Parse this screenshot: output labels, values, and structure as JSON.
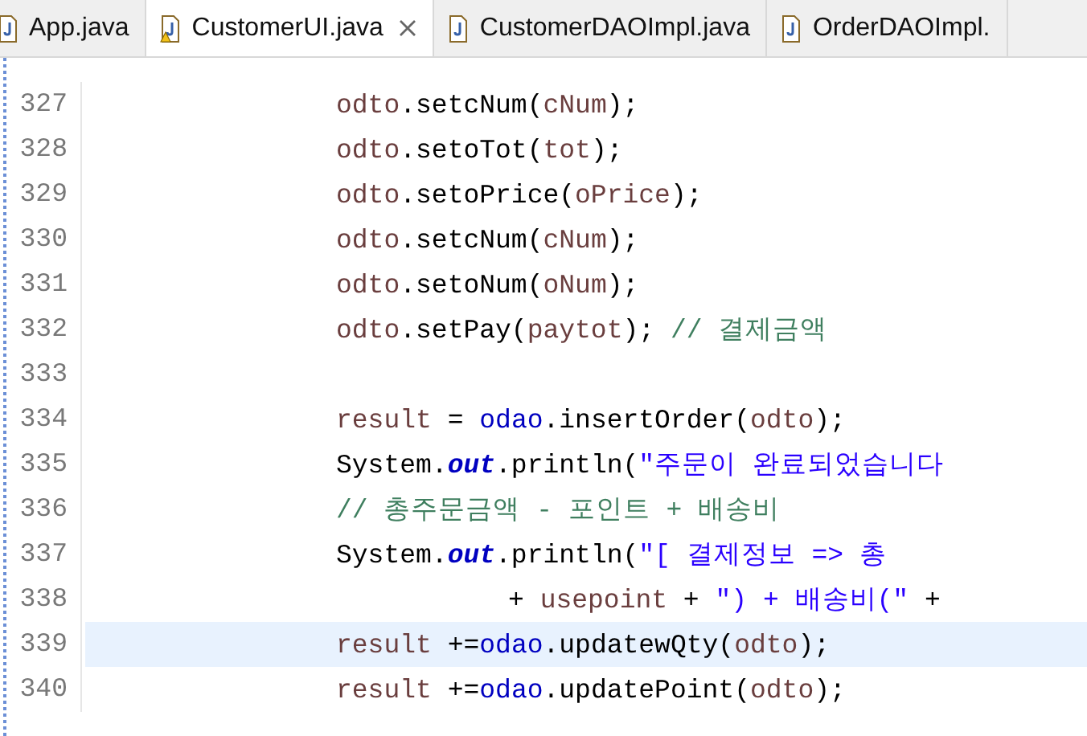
{
  "tabs": [
    {
      "label": "App.java",
      "selected": false,
      "warning": false,
      "closable": false
    },
    {
      "label": "CustomerUI.java",
      "selected": true,
      "warning": true,
      "closable": true
    },
    {
      "label": "CustomerDAOImpl.java",
      "selected": false,
      "warning": false,
      "closable": false
    },
    {
      "label": "OrderDAOImpl.",
      "selected": false,
      "warning": false,
      "closable": false
    }
  ],
  "lines": [
    {
      "number": "327",
      "kind": "code",
      "current": false,
      "tokens": [
        {
          "kind": "var",
          "text": "odto"
        },
        {
          "kind": "plain",
          "text": ".setcNum("
        },
        {
          "kind": "var",
          "text": "cNum"
        },
        {
          "kind": "plain",
          "text": ");"
        }
      ]
    },
    {
      "number": "328",
      "kind": "code",
      "current": false,
      "tokens": [
        {
          "kind": "var",
          "text": "odto"
        },
        {
          "kind": "plain",
          "text": ".setoTot("
        },
        {
          "kind": "var",
          "text": "tot"
        },
        {
          "kind": "plain",
          "text": ");"
        }
      ]
    },
    {
      "number": "329",
      "kind": "code",
      "current": false,
      "tokens": [
        {
          "kind": "var",
          "text": "odto"
        },
        {
          "kind": "plain",
          "text": ".setoPrice("
        },
        {
          "kind": "var",
          "text": "oPrice"
        },
        {
          "kind": "plain",
          "text": ");"
        }
      ]
    },
    {
      "number": "330",
      "kind": "code",
      "current": false,
      "tokens": [
        {
          "kind": "var",
          "text": "odto"
        },
        {
          "kind": "plain",
          "text": ".setcNum("
        },
        {
          "kind": "var",
          "text": "cNum"
        },
        {
          "kind": "plain",
          "text": ");"
        }
      ]
    },
    {
      "number": "331",
      "kind": "code",
      "current": false,
      "tokens": [
        {
          "kind": "var",
          "text": "odto"
        },
        {
          "kind": "plain",
          "text": ".setoNum("
        },
        {
          "kind": "var",
          "text": "oNum"
        },
        {
          "kind": "plain",
          "text": ");"
        }
      ]
    },
    {
      "number": "332",
      "kind": "code",
      "current": false,
      "tokens": [
        {
          "kind": "var",
          "text": "odto"
        },
        {
          "kind": "plain",
          "text": ".setPay("
        },
        {
          "kind": "var",
          "text": "paytot"
        },
        {
          "kind": "plain",
          "text": "); "
        },
        {
          "kind": "comment",
          "text": "// 결제금액"
        }
      ]
    },
    {
      "number": "333",
      "current": false
    },
    {
      "number": "334",
      "kind": "code",
      "current": false,
      "tokens": [
        {
          "kind": "var",
          "text": "result"
        },
        {
          "kind": "plain",
          "text": " = "
        },
        {
          "kind": "field",
          "text": "odao"
        },
        {
          "kind": "plain",
          "text": ".insertOrder("
        },
        {
          "kind": "var",
          "text": "odto"
        },
        {
          "kind": "plain",
          "text": ");"
        }
      ]
    },
    {
      "number": "335",
      "kind": "code",
      "current": false,
      "tokens": [
        {
          "kind": "plain",
          "text": "System."
        },
        {
          "kind": "static",
          "text": "out"
        },
        {
          "kind": "plain",
          "text": ".println("
        },
        {
          "kind": "string",
          "text": "\"주문이 완료되었습니다"
        }
      ]
    },
    {
      "number": "336",
      "kind": "code",
      "current": false,
      "tokens": [
        {
          "kind": "comment",
          "text": "// 총주문금액 - 포인트 + 배송비"
        }
      ]
    },
    {
      "number": "337",
      "kind": "code",
      "current": false,
      "tokens": [
        {
          "kind": "plain",
          "text": "System."
        },
        {
          "kind": "static",
          "text": "out"
        },
        {
          "kind": "plain",
          "text": ".println("
        },
        {
          "kind": "string",
          "text": "\"[ 결제정보 => 총"
        }
      ]
    },
    {
      "number": "338",
      "kind": "continuation",
      "current": false,
      "tokens": [
        {
          "kind": "plain",
          "text": "+ "
        },
        {
          "kind": "var",
          "text": "usepoint"
        },
        {
          "kind": "plain",
          "text": " + "
        },
        {
          "kind": "string",
          "text": "\") + 배송비(\""
        },
        {
          "kind": "plain",
          "text": " +"
        }
      ]
    },
    {
      "number": "339",
      "kind": "code",
      "current": true,
      "tokens": [
        {
          "kind": "var",
          "text": "result"
        },
        {
          "kind": "plain",
          "text": " +="
        },
        {
          "kind": "field",
          "text": "odao"
        },
        {
          "kind": "plain",
          "text": ".updatewQty("
        },
        {
          "kind": "var",
          "text": "odto"
        },
        {
          "kind": "plain",
          "text": ");"
        }
      ]
    },
    {
      "number": "340",
      "kind": "code",
      "current": false,
      "tokens": [
        {
          "kind": "var",
          "text": "result"
        },
        {
          "kind": "plain",
          "text": " +="
        },
        {
          "kind": "field",
          "text": "odao"
        },
        {
          "kind": "plain",
          "text": ".updatePoint("
        },
        {
          "kind": "var",
          "text": "odto"
        },
        {
          "kind": "plain",
          "text": ");"
        }
      ]
    }
  ]
}
